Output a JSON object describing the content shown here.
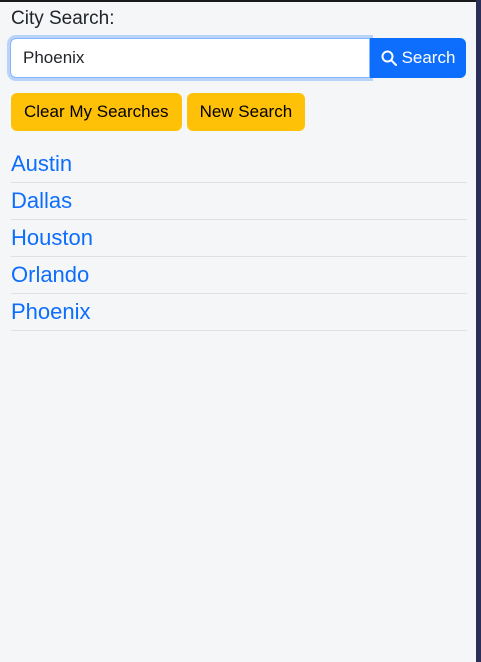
{
  "search": {
    "label": "City Search:",
    "value": "Phoenix",
    "button_label": "Search",
    "button_icon": "search-icon"
  },
  "actions": {
    "clear_label": "Clear My Searches",
    "new_label": "New Search"
  },
  "cities": [
    "Austin",
    "Dallas",
    "Houston",
    "Orlando",
    "Phoenix"
  ],
  "colors": {
    "primary": "#0d6efd",
    "warning": "#ffc107",
    "background": "#f5f6f8"
  }
}
